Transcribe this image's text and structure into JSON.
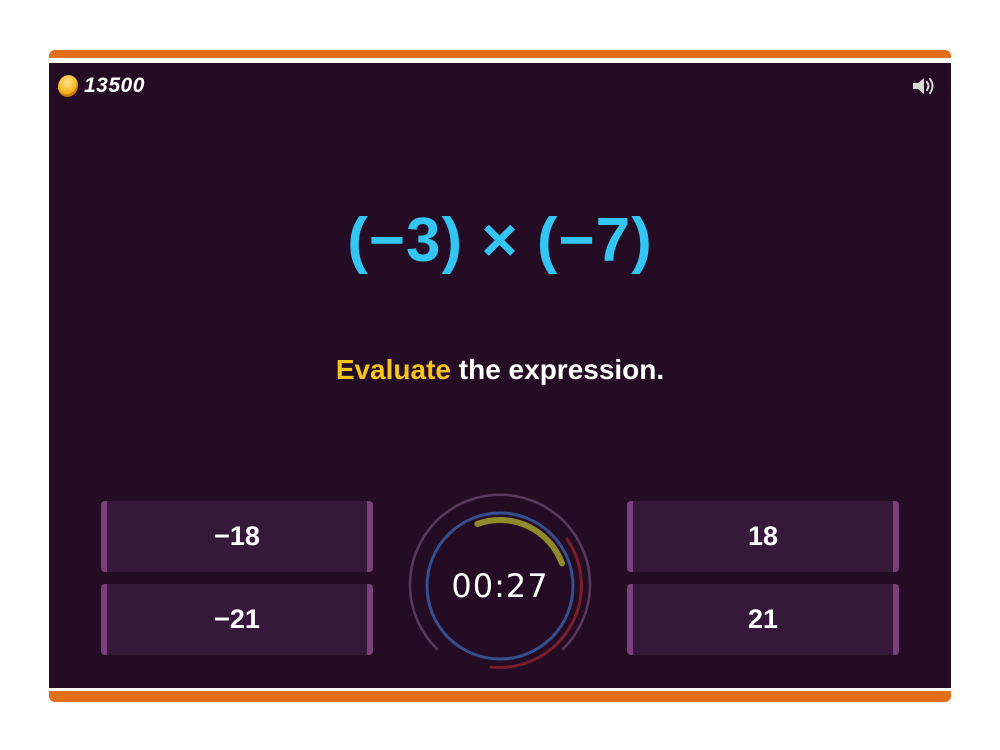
{
  "score": {
    "icon": "coin-icon",
    "value": "13500"
  },
  "sound": {
    "icon": "speaker-icon"
  },
  "question": {
    "expression": "(−3) × (−7)",
    "instruction_highlight": "Evaluate",
    "instruction_rest": " the expression."
  },
  "answers": [
    {
      "label": "−18"
    },
    {
      "label": "18"
    },
    {
      "label": "−21"
    },
    {
      "label": "21"
    }
  ],
  "timer": {
    "minutes": "00",
    "separator": " : ",
    "seconds": "27",
    "remaining_fraction": 0.45
  },
  "colors": {
    "frame_accent": "#e2701a",
    "stage_background": "#240d24",
    "expression": "#33c5f3",
    "highlight": "#f5c518",
    "answer_background": "#36193a",
    "answer_border": "#7b3f7e",
    "timer_progress": "#8f8a2a",
    "timer_inner_ring": "#35508f",
    "timer_outer_ring": "#5a3a5c",
    "timer_warning_arc": "#7a1e2a"
  }
}
